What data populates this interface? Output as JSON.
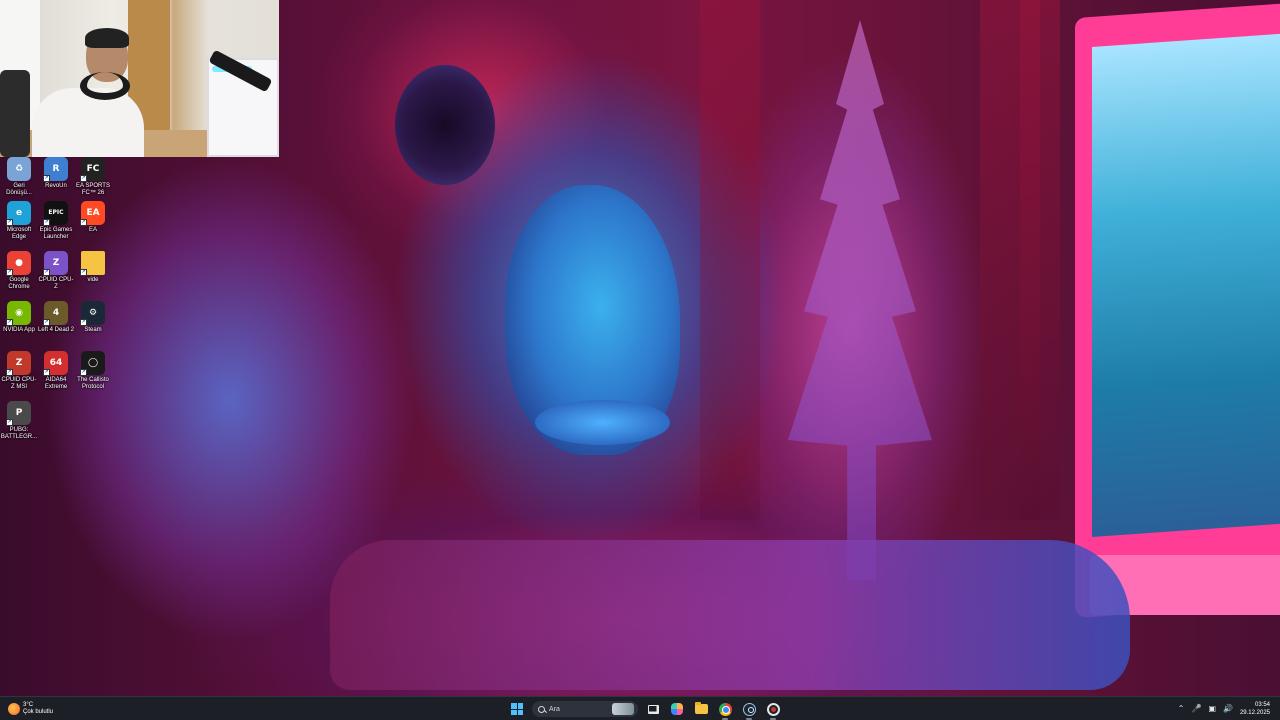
{
  "desktop": {
    "icons": [
      {
        "label": "Geri Dönüşü...",
        "icon": "recycle-bin-icon",
        "color": "#7aa4d6"
      },
      {
        "label": "RevoUn",
        "icon": "revo-uninstaller-icon",
        "color": "#3f7fd1"
      },
      {
        "label": "EA SPORTS FC™ 26",
        "icon": "ea-sports-fc-icon",
        "color": "#222222"
      },
      {
        "label": "Microsoft Edge",
        "icon": "edge-icon",
        "color": "#1fa2d8"
      },
      {
        "label": "Epic Games Launcher",
        "icon": "epic-games-icon",
        "color": "#111111"
      },
      {
        "label": "EA",
        "icon": "ea-icon",
        "color": "#ff4a23"
      },
      {
        "label": "Google Chrome",
        "icon": "chrome-icon",
        "color": "#ea4335"
      },
      {
        "label": "CPUID CPU-Z",
        "icon": "cpu-z-icon",
        "color": "#7b52c8"
      },
      {
        "label": "vide",
        "icon": "folder-icon",
        "color": "#f5c443"
      },
      {
        "label": "NVIDIA App",
        "icon": "nvidia-icon",
        "color": "#76b900"
      },
      {
        "label": "Left 4 Dead 2",
        "icon": "left-4-dead-icon",
        "color": "#6b5a2a"
      },
      {
        "label": "Steam",
        "icon": "steam-icon",
        "color": "#1b2838"
      },
      {
        "label": "CPUID CPU-Z MSI",
        "icon": "cpu-z-msi-icon",
        "color": "#c0392b"
      },
      {
        "label": "AIDA64 Extreme",
        "icon": "aida64-icon",
        "color": "#d32f2f"
      },
      {
        "label": "The Callisto Protocol",
        "icon": "callisto-icon",
        "color": "#1a1a1a"
      },
      {
        "label": "PUBG: BATTLEGR...",
        "icon": "pubg-icon",
        "color": "#4a4a4a"
      }
    ]
  },
  "taskbar": {
    "weather": {
      "temp": "3°C",
      "condition": "Çok bulutlu",
      "icon": "weather-icon"
    },
    "search": {
      "placeholder": "Ara"
    },
    "pinned": [
      {
        "name": "start-button",
        "icon": "windows-icon"
      },
      {
        "name": "task-view-button",
        "icon": "task-view-icon"
      },
      {
        "name": "copilot-button",
        "icon": "copilot-icon"
      },
      {
        "name": "file-explorer-button",
        "icon": "folder-icon"
      },
      {
        "name": "chrome-taskbar-button",
        "icon": "chrome-icon"
      },
      {
        "name": "steam-taskbar-button",
        "icon": "steam-icon"
      },
      {
        "name": "callisto-taskbar-button",
        "icon": "callisto-icon"
      }
    ],
    "tray": {
      "icons": [
        "chevron-up-icon",
        "microphone-icon",
        "network-icon",
        "volume-icon"
      ],
      "time": "03:54",
      "date": "29.12.2025"
    }
  },
  "colors": {
    "taskbar_bg": "#1c1f26",
    "accent": "#4cc2ff"
  }
}
